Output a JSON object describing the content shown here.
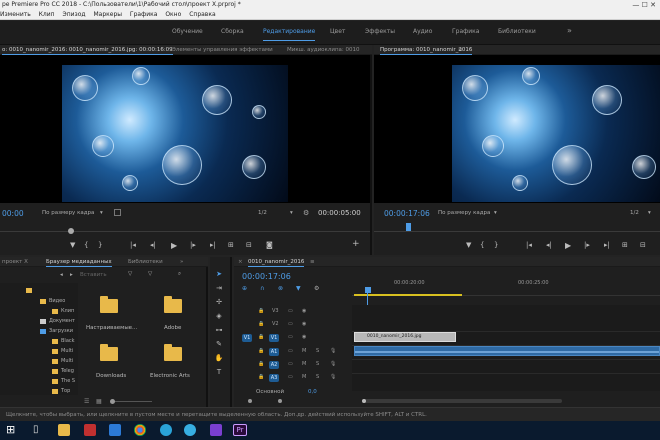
{
  "window": {
    "title": "pe Premiere Pro CC 2018 - C:\\Пользователи\\1\\Рабочий стол\\проект X.prproj *",
    "controls": "—  ☐  ✕"
  },
  "menu": [
    "Изменить",
    "Клип",
    "Эпизод",
    "Маркеры",
    "Графика",
    "Окно",
    "Справка"
  ],
  "workspaces": {
    "items": [
      "Обучение",
      "Сборка",
      "Редактирование",
      "Цвет",
      "Эффекты",
      "Аудио",
      "Графика",
      "Библиотеки"
    ],
    "active_index": 2,
    "overflow": "»"
  },
  "source_monitor": {
    "tabs": [
      "о: 0010_nanomir_2016: 0010_nanomir_2016.jpg: 00:00:16:09",
      "Элементы управления эффектами",
      "Микш. аудиоклипа: 0010"
    ],
    "menu_glyph": "≡",
    "timecode_in": "00:00",
    "fit": "По размеру кадра",
    "resolution": "1/2",
    "timecode_out": "00:00:05:00"
  },
  "program_monitor": {
    "tab": "Программа: 0010_nanomir_2016",
    "menu_glyph": "≡",
    "timecode": "00:00:17:06",
    "fit": "По размеру кадра",
    "resolution": "1/2"
  },
  "project_panel": {
    "tabs": [
      "проект X",
      "Браузер медиаданных",
      "Библиотеки"
    ],
    "insert_label": "Вставить",
    "tree": [
      "Видео",
      "Клип",
      "Документ",
      "Загрузки",
      "Black",
      "Multi",
      "Multi",
      "Teleg",
      "The S",
      "Тор"
    ],
    "folders": [
      "Настраиваемые...",
      "Adobe",
      "Downloads",
      "Electronic Arts"
    ]
  },
  "timeline": {
    "tab": "0010_nanomir_2016",
    "timecode": "00:00:17:06",
    "ruler": [
      "00:00:20:00",
      "00:00:25:00"
    ],
    "video_tracks": [
      "V3",
      "V2",
      "V1"
    ],
    "audio_tracks": [
      "A1",
      "A2",
      "A3"
    ],
    "source_patch_v": "V1",
    "source_patch_a": "A1",
    "master_label": "Основной",
    "master_value": "0,0",
    "clip_name": "0010_nanomir_2016.jpg",
    "mute": "M",
    "solo": "S"
  },
  "status": "Щелкните, чтобы выбрать, или щелкните в пустом месте и перетащите выделенную область. Доп.др. действий используйте SHIFT, ALT и CTRL.",
  "taskbar": {
    "pr_label": "Pr"
  },
  "colors": {
    "accent": "#4e9ce6",
    "timeline_selected": "#1e5c94",
    "folder": "#e8b94a",
    "taskbar": "#0a1a2e"
  }
}
